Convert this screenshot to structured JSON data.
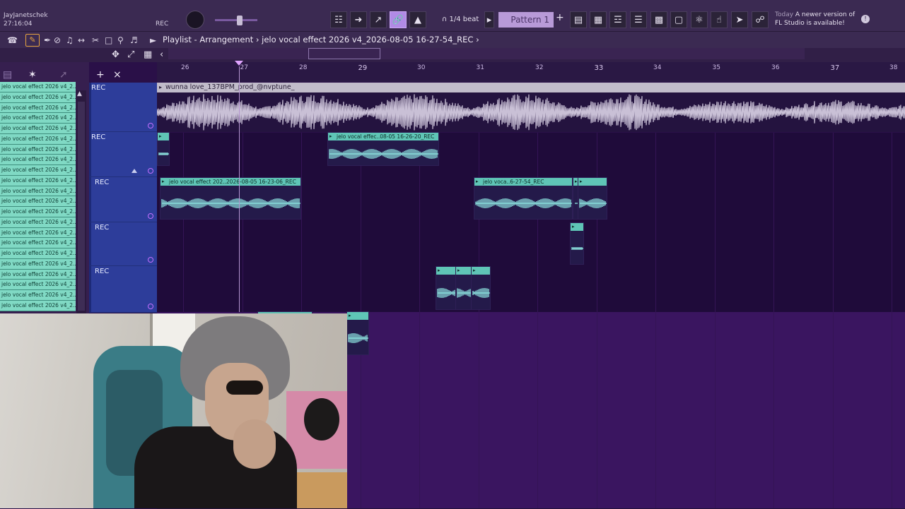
{
  "user": {
    "name": "JayJanetschek",
    "time": "27:16:04"
  },
  "toolbar": {
    "rec_label": "REC",
    "snap": "1/4 beat",
    "pattern": "Pattern 1",
    "plus": "+",
    "news_today": "Today",
    "news_text_1": "A newer version of",
    "news_text_2": "FL Studio is available!"
  },
  "breadcrumb": "Playlist - Arrangement  ›  jelo vocal effect 2026 v4_2026-08-05 16-27-54_REC  ›",
  "ruler": {
    "bars": [
      "26",
      "27",
      "28",
      "29",
      "30",
      "31",
      "32",
      "33",
      "34",
      "35",
      "36",
      "37",
      "38"
    ],
    "major": [
      "29",
      "33",
      "37"
    ]
  },
  "pattern_list": {
    "items": [
      "jelo vocal effect 2026 v4_2...",
      "jelo vocal effect 2026 v4_2...",
      "jelo vocal effect 2026 v4_2...",
      "jelo vocal effect 2026 v4_2...",
      "jelo vocal effect 2026 v4_2...",
      "jelo vocal effect 2026 v4_2...",
      "jelo vocal effect 2026 v4_2...",
      "jelo vocal effect 2026 v4_2...",
      "jelo vocal effect 2026 v4_2...",
      "jelo vocal effect 2026 v4_2...",
      "jelo vocal effect 2026 v4_2...",
      "jelo vocal effect 2026 v4_2...",
      "jelo vocal effect 2026 v4_2...",
      "jelo vocal effect 2026 v4_2...",
      "jelo vocal effect 2026 v4_2...",
      "jelo vocal effect 2026 v4_2...",
      "jelo vocal effect 2026 v4_2...",
      "jelo vocal effect 2026 v4_2...",
      "jelo vocal effect 2026 v4_2...",
      "jelo vocal effect 2026 v4_2...",
      "jelo vocal effect 2026 v4_2...",
      "jelo vocal effect 2026 v4_2..."
    ]
  },
  "tracks": [
    {
      "label": "REC"
    },
    {
      "label": "REC"
    },
    {
      "label": "REC"
    },
    {
      "label": "REC"
    },
    {
      "label": "REC"
    }
  ],
  "audio_clip": {
    "name": "wunna love_137BPM_prod_@nvptune_"
  },
  "clips": [
    {
      "name": ""
    },
    {
      "name": "jelo vocal effec..08-05 16-26-20_REC"
    },
    {
      "name": "jelo vocal effect 202..2026-08-05 16-23-06_REC"
    },
    {
      "name": "jelo voca..6-27-54_REC"
    },
    {
      "name": ""
    },
    {
      "name": ""
    },
    {
      "name": ""
    },
    {
      "name": ""
    },
    {
      "name": ""
    },
    {
      "name": ""
    },
    {
      "name": ""
    },
    {
      "name": ""
    }
  ],
  "colors": {
    "clip_header": "#5fc5b6",
    "pattern_item": "#80d9c4",
    "track_header": "#2d3d9a",
    "tool_active": "#b18ae6",
    "background": "#2a1048"
  },
  "icons": [
    "piano-icon",
    "arrow-icon",
    "draw-icon",
    "link-icon",
    "stamp-icon",
    "mixer-icon",
    "channel-rack-icon",
    "browser-icon",
    "plugin-icon",
    "cart-icon",
    "magnet-icon",
    "pencil-icon",
    "brush-icon",
    "mute-icon",
    "slip-icon",
    "slice-icon",
    "select-icon",
    "zoom-icon",
    "speaker-icon",
    "warning-icon"
  ]
}
